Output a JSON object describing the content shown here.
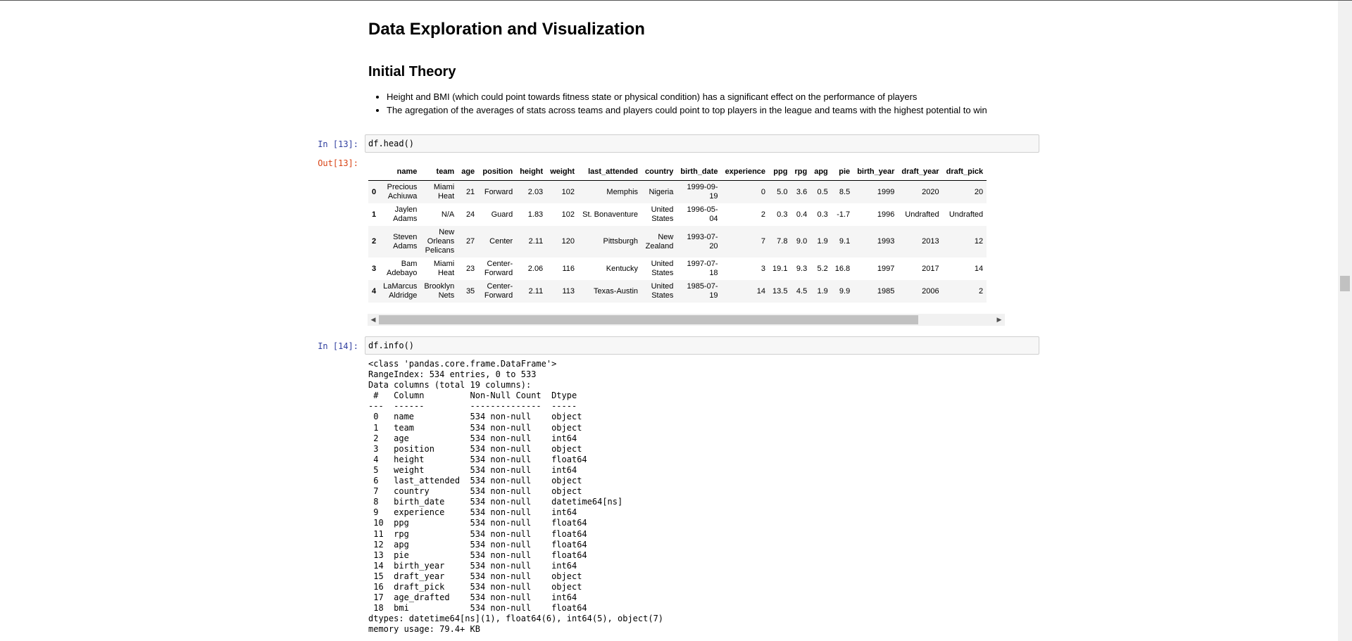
{
  "markdown": {
    "title": "Data Exploration and Visualization",
    "subtitle": "Initial Theory",
    "bullets": [
      "Height and BMI (which could point towards fitness state or physical condition) has a significant effect on the performance of players",
      "The agregation of the averages of stats across teams and players could point to top players in the league and teams with the highest potential to win"
    ]
  },
  "cells": [
    {
      "in_prompt": "In [13]:",
      "code": "df.head()",
      "out_prompt": "Out[13]:"
    },
    {
      "in_prompt": "In [14]:",
      "code": "df.info()"
    }
  ],
  "dataframe": {
    "columns": [
      "",
      "name",
      "team",
      "age",
      "position",
      "height",
      "weight",
      "last_attended",
      "country",
      "birth_date",
      "experience",
      "ppg",
      "rpg",
      "apg",
      "pie",
      "birth_year",
      "draft_year",
      "draft_pick"
    ],
    "rows": [
      [
        "0",
        "Precious Achiuwa",
        "Miami Heat",
        "21",
        "Forward",
        "2.03",
        "102",
        "Memphis",
        "Nigeria",
        "1999-09-19",
        "0",
        "5.0",
        "3.6",
        "0.5",
        "8.5",
        "1999",
        "2020",
        "20"
      ],
      [
        "1",
        "Jaylen Adams",
        "N/A",
        "24",
        "Guard",
        "1.83",
        "102",
        "St. Bonaventure",
        "United States",
        "1996-05-04",
        "2",
        "0.3",
        "0.4",
        "0.3",
        "-1.7",
        "1996",
        "Undrafted",
        "Undrafted"
      ],
      [
        "2",
        "Steven Adams",
        "New Orleans Pelicans",
        "27",
        "Center",
        "2.11",
        "120",
        "Pittsburgh",
        "New Zealand",
        "1993-07-20",
        "7",
        "7.8",
        "9.0",
        "1.9",
        "9.1",
        "1993",
        "2013",
        "12"
      ],
      [
        "3",
        "Bam Adebayo",
        "Miami Heat",
        "23",
        "Center-Forward",
        "2.06",
        "116",
        "Kentucky",
        "United States",
        "1997-07-18",
        "3",
        "19.1",
        "9.3",
        "5.2",
        "16.8",
        "1997",
        "2017",
        "14"
      ],
      [
        "4",
        "LaMarcus Aldridge",
        "Brooklyn Nets",
        "35",
        "Center-Forward",
        "2.11",
        "113",
        "Texas-Austin",
        "United States",
        "1985-07-19",
        "14",
        "13.5",
        "4.5",
        "1.9",
        "9.9",
        "1985",
        "2006",
        "2"
      ]
    ]
  },
  "info_output": "<class 'pandas.core.frame.DataFrame'>\nRangeIndex: 534 entries, 0 to 533\nData columns (total 19 columns):\n #   Column         Non-Null Count  Dtype\n---  ------         --------------  -----\n 0   name           534 non-null    object\n 1   team           534 non-null    object\n 2   age            534 non-null    int64\n 3   position       534 non-null    object\n 4   height         534 non-null    float64\n 5   weight         534 non-null    int64\n 6   last_attended  534 non-null    object\n 7   country        534 non-null    object\n 8   birth_date     534 non-null    datetime64[ns]\n 9   experience     534 non-null    int64\n 10  ppg            534 non-null    float64\n 11  rpg            534 non-null    float64\n 12  apg            534 non-null    float64\n 13  pie            534 non-null    float64\n 14  birth_year     534 non-null    int64\n 15  draft_year     534 non-null    object\n 16  draft_pick     534 non-null    object\n 17  age_drafted    534 non-null    int64\n 18  bmi            534 non-null    float64\ndtypes: datetime64[ns](1), float64(6), int64(5), object(7)\nmemory usage: 79.4+ KB",
  "icons": {
    "scroll_left": "◀",
    "scroll_right": "▶"
  }
}
